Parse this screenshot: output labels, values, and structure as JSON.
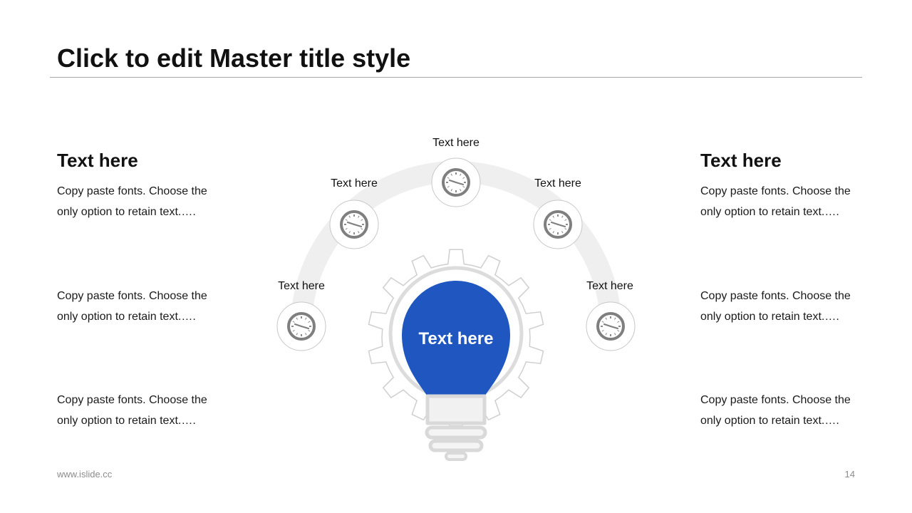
{
  "slide": {
    "title": "Click to edit Master title style"
  },
  "left_column": {
    "heading": "Text here",
    "paragraphs": [
      "Copy paste fonts. Choose the only option to retain text.….",
      "Copy paste fonts. Choose the only option to retain text.….",
      "Copy paste fonts. Choose the only option to retain text.…."
    ]
  },
  "right_column": {
    "heading": "Text here",
    "paragraphs": [
      "Copy paste fonts. Choose the only option to retain text.….",
      "Copy paste fonts. Choose the only option to retain text.….",
      "Copy paste fonts. Choose the only option to retain text.…."
    ]
  },
  "diagram": {
    "center_label": "Text here",
    "nodes": [
      {
        "label": "Text here",
        "icon": "clock-icon"
      },
      {
        "label": "Text here",
        "icon": "clock-icon"
      },
      {
        "label": "Text here",
        "icon": "clock-icon"
      },
      {
        "label": "Text here",
        "icon": "clock-icon"
      },
      {
        "label": "Text here",
        "icon": "clock-icon"
      }
    ],
    "colors": {
      "bulb": "#1f56c0",
      "arc": "#efefef",
      "icon": "#7f7f7f"
    }
  },
  "footer": {
    "url": "www.islide.cc",
    "page_number": "14"
  }
}
